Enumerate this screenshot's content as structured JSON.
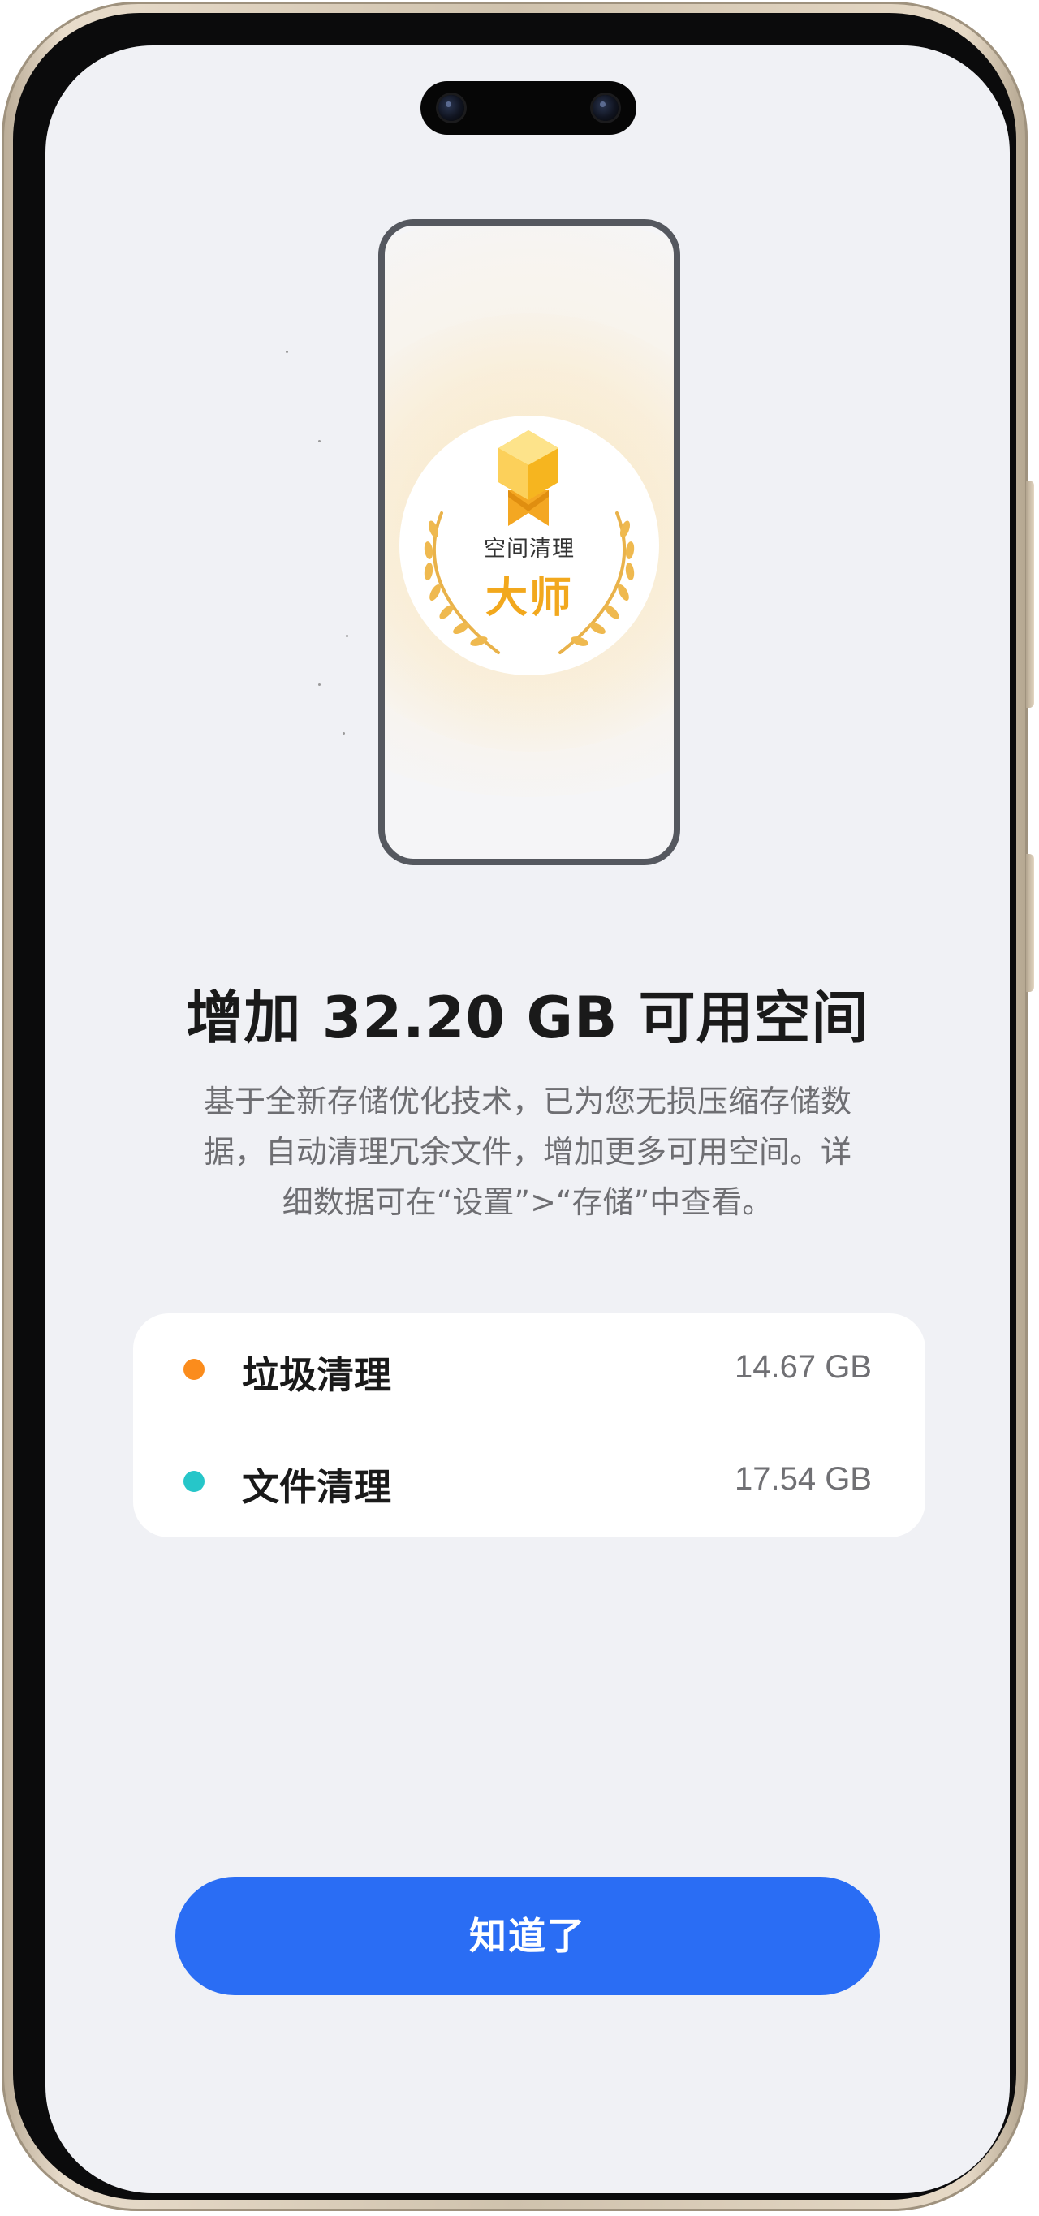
{
  "illustration": {
    "badge_title": "空间清理",
    "badge_big": "大师",
    "colors": {
      "gold": "#f2a81d",
      "medal_top": "#fcd34d",
      "ribbon": "#f4a722"
    }
  },
  "headline": "增加 32.20 GB 可用空间",
  "description": {
    "line1": "基于全新存储优化技术，已为您无损压缩存储数",
    "line2": "据，自动清理冗余文件，增加更多可用空间。详",
    "line3": "细数据可在“设置”>“存储”中查看。"
  },
  "cleanup": {
    "items": [
      {
        "label": "垃圾清理",
        "value": "14.67 GB",
        "dot_color": "#fb8c1c"
      },
      {
        "label": "文件清理",
        "value": "17.54 GB",
        "dot_color": "#26c6c9"
      }
    ]
  },
  "button": {
    "label": "知道了",
    "color": "#2a6df4"
  },
  "colors": {
    "screen_bg": "#f0f1f5",
    "card_bg": "#ffffff"
  }
}
